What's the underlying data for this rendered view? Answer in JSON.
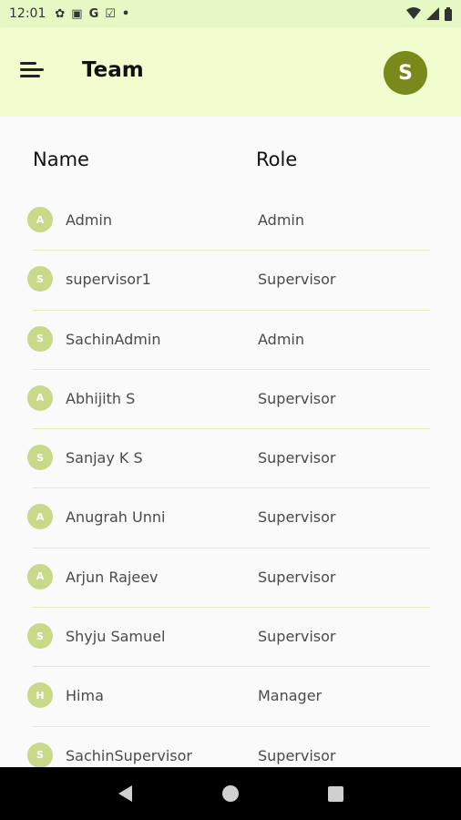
{
  "status_bar": {
    "time": "12:01",
    "icons": [
      "gear-icon",
      "image-icon",
      "g-icon",
      "checklist-icon",
      "dot-icon"
    ],
    "right_icons": [
      "wifi-icon",
      "signal-icon",
      "battery-icon"
    ]
  },
  "app_bar": {
    "title": "Team",
    "avatar_letter": "S"
  },
  "table": {
    "header_name": "Name",
    "header_role": "Role",
    "rows": [
      {
        "initial": "A",
        "name": "Admin",
        "role": "Admin"
      },
      {
        "initial": "S",
        "name": "supervisor1",
        "role": "Supervisor"
      },
      {
        "initial": "S",
        "name": "SachinAdmin",
        "role": "Admin"
      },
      {
        "initial": "A",
        "name": "Abhijith S",
        "role": "Supervisor"
      },
      {
        "initial": "S",
        "name": "Sanjay K S",
        "role": "Supervisor"
      },
      {
        "initial": "A",
        "name": "Anugrah Unni",
        "role": "Supervisor"
      },
      {
        "initial": "A",
        "name": "Arjun Rajeev",
        "role": "Supervisor"
      },
      {
        "initial": "S",
        "name": "Shyju Samuel",
        "role": "Supervisor"
      },
      {
        "initial": "H",
        "name": "Hima",
        "role": "Manager"
      },
      {
        "initial": "S",
        "name": "SachinSupervisor",
        "role": "Supervisor"
      }
    ]
  },
  "colors": {
    "app_bar_bg": "#f1fdcf",
    "avatar_bg": "#7a8a1a",
    "badge_bg": "#c9d98a"
  }
}
